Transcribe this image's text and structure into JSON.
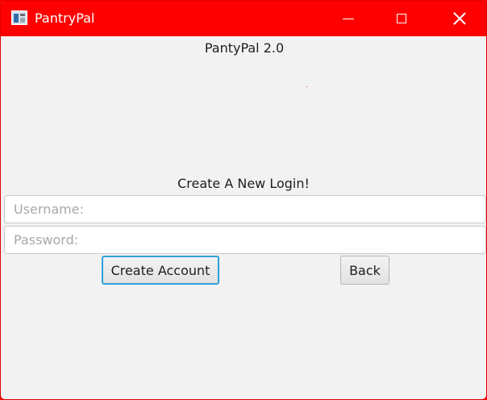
{
  "window": {
    "title": "PantryPal",
    "icon": "app-icon",
    "controls": [
      "minimize-icon",
      "maximize-icon",
      "close-icon"
    ]
  },
  "colors": {
    "titlebar": "#ff0000",
    "background": "#f3f2f2",
    "focus_ring": "#2ea0db"
  },
  "main": {
    "app_heading": "PantyPal 2.0",
    "form_heading": "Create A New Login!",
    "username": {
      "value": "",
      "placeholder": "Username:"
    },
    "password": {
      "value": "",
      "placeholder": "Password:"
    },
    "create_account_label": "Create Account",
    "back_label": "Back"
  }
}
